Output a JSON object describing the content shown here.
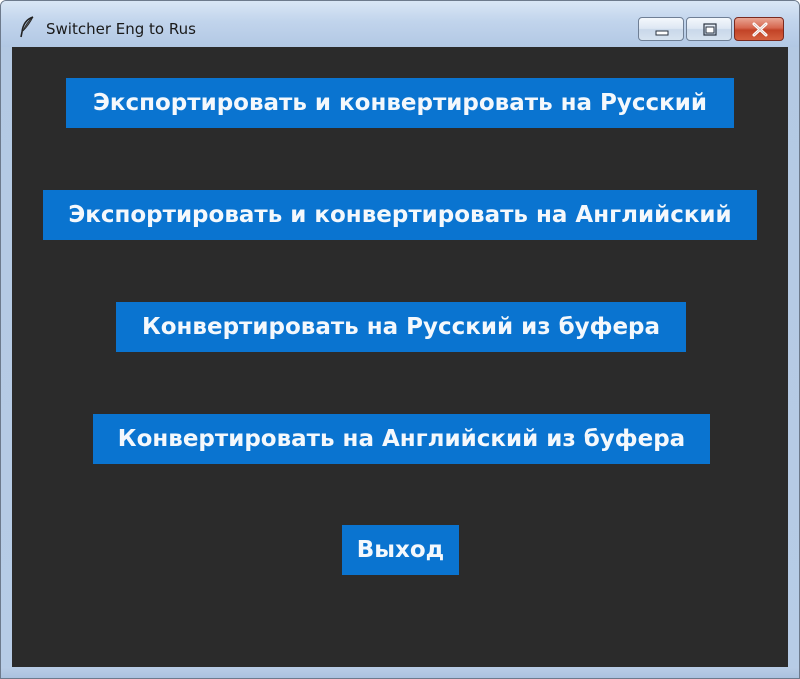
{
  "window": {
    "title": "Switcher Eng to Rus",
    "icon": "feather-icon",
    "controls": [
      "minimize-icon",
      "maximize-icon",
      "close-icon"
    ]
  },
  "buttons": {
    "export_convert_ru": "Экспортировать и конвертировать на Русский",
    "export_convert_en": "Экспортировать и конвертировать на Английский",
    "convert_ru_clipboard": "Конвертировать на Русский из буфера",
    "convert_en_clipboard": "Конвертировать на Английский из буфера",
    "exit": "Выход"
  },
  "colors": {
    "background": "#2b2b2b",
    "button": "#0a74d0",
    "button_text": "#f4f8fc",
    "close_button": "#c9452a"
  }
}
